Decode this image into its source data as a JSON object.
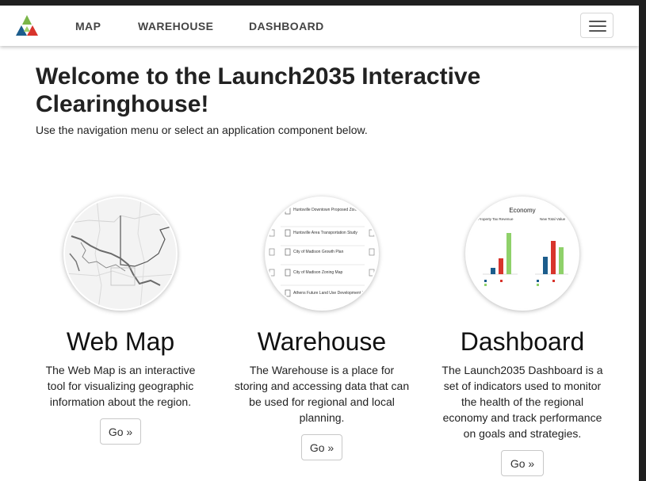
{
  "nav": {
    "items": [
      {
        "label": "MAP"
      },
      {
        "label": "WAREHOUSE"
      },
      {
        "label": "DASHBOARD"
      }
    ],
    "logo_colors": [
      "#7ab648",
      "#1c5d8c",
      "#d8342c"
    ]
  },
  "hero": {
    "title": "Welcome to the Launch2035 Interactive Clearinghouse!",
    "subtitle": "Use the navigation menu or select an application component below."
  },
  "components": [
    {
      "title": "Web Map",
      "description": "The Web Map is an interactive tool for visualizing geographic information about the region.",
      "button": "Go »"
    },
    {
      "title": "Warehouse",
      "description": "The Warehouse is a place for storing and accessing data that can be used for regional and local planning.",
      "button": "Go »",
      "thumb_items": [
        "Huntsville Downtown Proposed Zoning Map",
        "Huntsville Area Transportation Study",
        "City of Madison Growth Plan",
        "City of Madison Zoning Map",
        "Athens Future Land Use Development Plan"
      ]
    },
    {
      "title": "Dashboard",
      "description": "The Launch2035 Dashboard is a set of indicators used to monitor the health of the regional economy and track performance on goals and strategies.",
      "button": "Go »",
      "thumb_heading": "Economy",
      "thumb_charts": [
        "Property Tax Revenue",
        "New Total Value"
      ]
    }
  ]
}
